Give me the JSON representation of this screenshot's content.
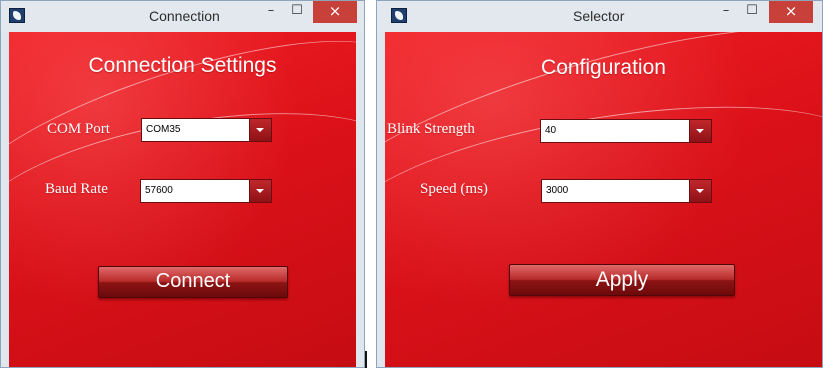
{
  "windows": {
    "connection": {
      "title": "Connection",
      "heading": "Connection Settings",
      "com_port": {
        "label": "COM Port",
        "value": "COM35"
      },
      "baud_rate": {
        "label": "Baud Rate",
        "value": "57600"
      },
      "button_label": "Connect"
    },
    "selector": {
      "title": "Selector",
      "heading": "Configuration",
      "blink_strength": {
        "label": "Blink Strength",
        "value": "40"
      },
      "speed": {
        "label": "Speed (ms)",
        "value": "3000"
      },
      "button_label": "Apply"
    }
  },
  "titlebar_controls": {
    "minimize": "–",
    "maximize": "☐",
    "close": "×"
  },
  "icons": {
    "app": "app-logo-icon",
    "dropdown": "chevron-down-icon"
  },
  "colors": {
    "client_background": "#d9141d",
    "close_button": "#c7413a",
    "button_gradient_top": "#e06a6a",
    "button_gradient_bottom": "#6d0a0b"
  }
}
